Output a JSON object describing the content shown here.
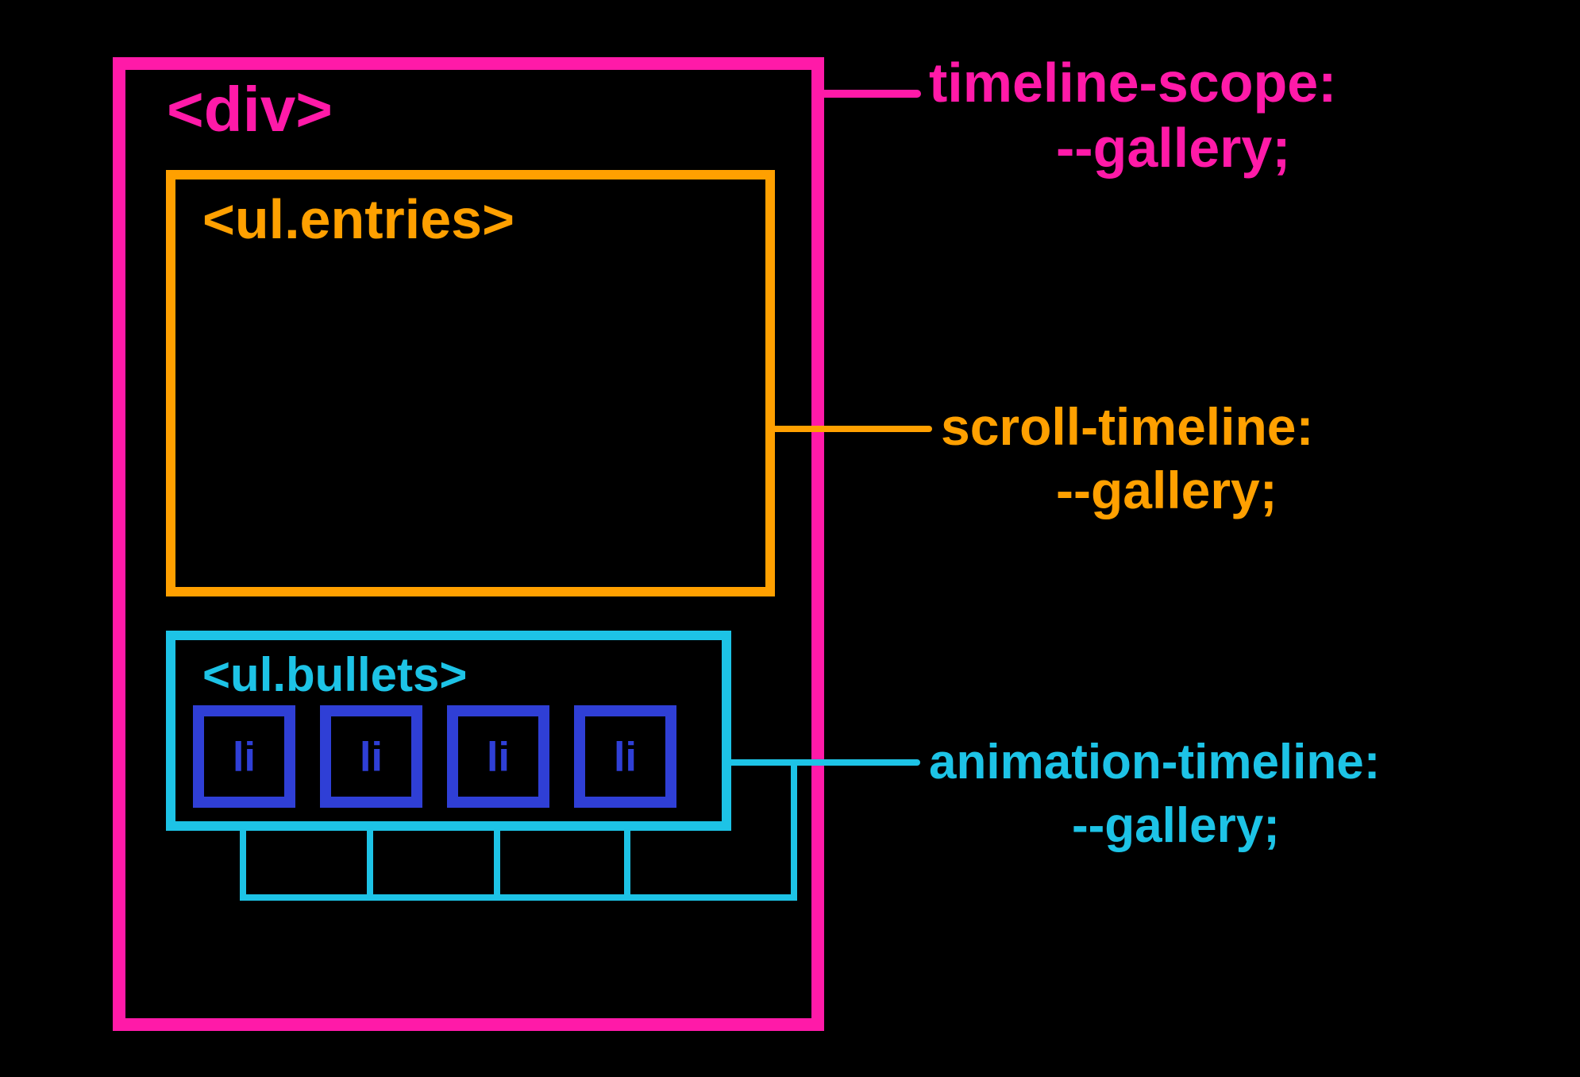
{
  "colors": {
    "bg": "#000000",
    "magenta": "#ff1aa8",
    "orange": "#ffa000",
    "lightblue": "#1dc3e6",
    "darkblue": "#2f3fd6"
  },
  "outerDiv": {
    "tagLabel": "<div>"
  },
  "entries": {
    "tagLabel": "<ul.entries>"
  },
  "bullets": {
    "tagLabel": "<ul.bullets>",
    "items": [
      "li",
      "li",
      "li",
      "li"
    ]
  },
  "annotations": {
    "timelineScope": {
      "line1": "timeline-scope:",
      "line2": "--gallery;"
    },
    "scrollTimeline": {
      "line1": "scroll-timeline:",
      "line2": "--gallery;"
    },
    "animationTimeline": {
      "line1": "animation-timeline:",
      "line2": "--gallery;"
    }
  }
}
